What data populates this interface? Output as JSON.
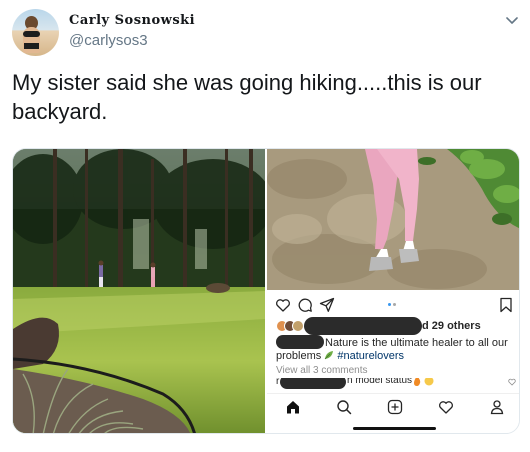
{
  "tweet": {
    "display_name": "Carly Sosnowski",
    "handle": "@carlysos3",
    "text": "My sister said she was going hiking.....this is our backyard.",
    "avatar_icon": "avatar-photo",
    "menu_icon": "chevron-down-icon"
  },
  "instagram": {
    "likes_suffix": "d 29 others",
    "caption_line1": "Nature is the ultimate healer to all our",
    "caption_line2_prefix": "problems",
    "caption_hashtag": "#naturelovers",
    "view_comments": "View all 3 comments",
    "comment_text": "n model status",
    "comment_leading_char": "r",
    "action_icons": [
      "heart-icon",
      "comment-icon",
      "share-icon",
      "bookmark-icon"
    ],
    "nav_icons": [
      "home-icon",
      "search-icon",
      "add-post-icon",
      "activity-heart-icon",
      "profile-icon"
    ]
  },
  "colors": {
    "text_primary": "#14171a",
    "text_secondary": "#657786",
    "border": "#e1e8ed",
    "hashtag": "#003569",
    "ig_text": "#262626",
    "ig_muted": "#8e8e8e",
    "ig_dot_active": "#3897f0"
  }
}
